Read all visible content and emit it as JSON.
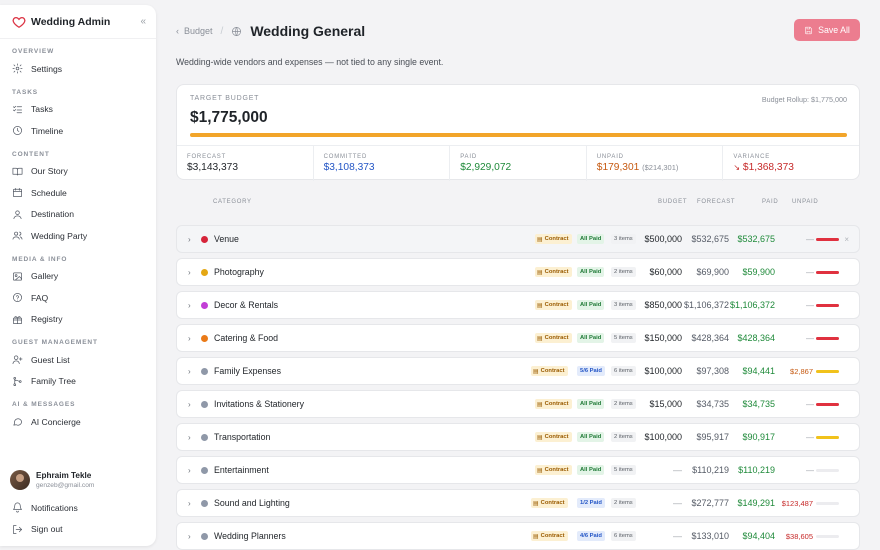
{
  "app": {
    "title": "Wedding Admin",
    "collapse_icon": "«"
  },
  "sidebar": {
    "sections": [
      {
        "label": "Overview",
        "items": [
          {
            "label": "Settings",
            "icon": "gear-icon"
          }
        ]
      },
      {
        "label": "Tasks",
        "items": [
          {
            "label": "Tasks",
            "icon": "checklist-icon"
          },
          {
            "label": "Timeline",
            "icon": "clock-icon"
          }
        ]
      },
      {
        "label": "Content",
        "items": [
          {
            "label": "Our Story",
            "icon": "book-icon"
          },
          {
            "label": "Schedule",
            "icon": "calendar-icon"
          },
          {
            "label": "Destination",
            "icon": "map-pin-icon"
          },
          {
            "label": "Wedding Party",
            "icon": "users-icon"
          }
        ]
      },
      {
        "label": "Media & Info",
        "items": [
          {
            "label": "Gallery",
            "icon": "image-icon"
          },
          {
            "label": "FAQ",
            "icon": "help-icon"
          },
          {
            "label": "Registry",
            "icon": "gift-icon"
          }
        ]
      },
      {
        "label": "Guest Management",
        "items": [
          {
            "label": "Guest List",
            "icon": "user-plus-icon"
          },
          {
            "label": "Family Tree",
            "icon": "tree-icon"
          }
        ]
      },
      {
        "label": "AI & Messages",
        "items": [
          {
            "label": "AI Concierge",
            "icon": "chat-icon"
          }
        ]
      }
    ],
    "user": {
      "name": "Ephraim Tekle",
      "email": "genzeb@gmail.com"
    },
    "notifications_label": "Notifications",
    "signout_label": "Sign out"
  },
  "header": {
    "back_label": "Budget",
    "separator": "/",
    "title": "Wedding General",
    "save_label": "Save All"
  },
  "subtitle": "Wedding-wide vendors and expenses — not tied to any single event.",
  "budget": {
    "target_label": "Target Budget",
    "target_value": "$1,775,000",
    "rollup": "Budget Rollup: $1,775,000",
    "progress_fraction": 1.0,
    "progress_color": "#f2a52a",
    "stats": {
      "forecast": {
        "label": "Forecast",
        "value": "$3,143,373"
      },
      "committed": {
        "label": "Committed",
        "value": "$3,108,373"
      },
      "paid": {
        "label": "Paid",
        "value": "$2,929,072"
      },
      "unpaid": {
        "label": "Unpaid",
        "value": "$179,301",
        "sub": "($214,301)"
      },
      "variance": {
        "label": "Variance",
        "value": "$1,368,373",
        "icon": "trend-down-icon"
      }
    }
  },
  "table": {
    "headers": {
      "category": "Category",
      "budget": "Budget",
      "forecast": "Forecast",
      "paid": "Paid",
      "unpaid": "Unpaid"
    },
    "rows": [
      {
        "name": "Venue",
        "dot": "#d6243a",
        "contract": "Contract",
        "paid_status": "All Paid",
        "items": "3 items",
        "budget": "$500,000",
        "forecast": "$532,675",
        "paid": "$532,675",
        "unpaid": "—",
        "unpaid_fill": 1.0,
        "bar_color": "#e0313f"
      },
      {
        "name": "Photography",
        "dot": "#e4a714",
        "contract": "Contract",
        "paid_status": "All Paid",
        "items": "2 items",
        "budget": "$60,000",
        "forecast": "$69,900",
        "paid": "$59,900",
        "unpaid": "—",
        "unpaid_fill": 1.0,
        "bar_color": "#e0313f"
      },
      {
        "name": "Decor & Rentals",
        "dot": "#c23fd6",
        "contract": "Contract",
        "paid_status": "All Paid",
        "items": "3 items",
        "budget": "$850,000",
        "forecast": "$1,106,372",
        "paid": "$1,106,372",
        "unpaid": "—",
        "unpaid_fill": 1.0,
        "bar_color": "#e0313f"
      },
      {
        "name": "Catering & Food",
        "dot": "#ea7a18",
        "contract": "Contract",
        "paid_status": "All Paid",
        "items": "5 items",
        "budget": "$150,000",
        "forecast": "$428,364",
        "paid": "$428,364",
        "unpaid": "—",
        "unpaid_fill": 1.0,
        "bar_color": "#e0313f"
      },
      {
        "name": "Family Expenses",
        "dot": "#8f98a8",
        "contract": "Contract",
        "paid_status": "5/6 Paid",
        "items": "6 items",
        "budget": "$100,000",
        "forecast": "$97,308",
        "paid": "$94,441",
        "unpaid": "$2,867",
        "unpaid_fill": 1.0,
        "bar_color": "#f1c21b"
      },
      {
        "name": "Invitations & Stationery",
        "dot": "#8f98a8",
        "contract": "Contract",
        "paid_status": "All Paid",
        "items": "2 items",
        "budget": "$15,000",
        "forecast": "$34,735",
        "paid": "$34,735",
        "unpaid": "—",
        "unpaid_fill": 1.0,
        "bar_color": "#e0313f"
      },
      {
        "name": "Transportation",
        "dot": "#8f98a8",
        "contract": "Contract",
        "paid_status": "All Paid",
        "items": "2 items",
        "budget": "$100,000",
        "forecast": "$95,917",
        "paid": "$90,917",
        "unpaid": "—",
        "unpaid_fill": 1.0,
        "bar_color": "#f1c21b"
      },
      {
        "name": "Entertainment",
        "dot": "#8f98a8",
        "contract": "Contract",
        "paid_status": "All Paid",
        "items": "5 items",
        "budget": "—",
        "forecast": "$110,219",
        "paid": "$110,219",
        "unpaid": "—",
        "unpaid_fill": 0,
        "bar_color": "#e0313f"
      },
      {
        "name": "Sound and Lighting",
        "dot": "#8f98a8",
        "contract": "Contract",
        "paid_status": "1/2 Paid",
        "items": "2 items",
        "budget": "—",
        "forecast": "$272,777",
        "paid": "$149,291",
        "unpaid": "$123,487",
        "unpaid_fill": 0,
        "bar_color": "#e0313f"
      },
      {
        "name": "Wedding Planners",
        "dot": "#8f98a8",
        "contract": "Contract",
        "paid_status": "4/6 Paid",
        "items": "6 items",
        "budget": "—",
        "forecast": "$133,010",
        "paid": "$94,404",
        "unpaid": "$38,605",
        "unpaid_fill": 0,
        "bar_color": "#e0313f"
      }
    ]
  }
}
